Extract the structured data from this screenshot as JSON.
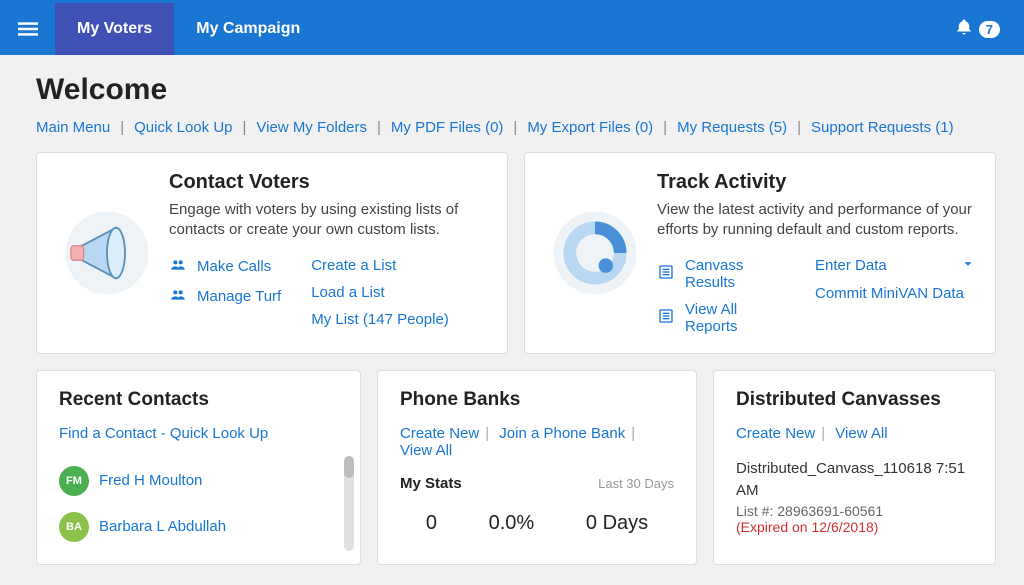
{
  "nav": {
    "items": [
      "My Voters",
      "My Campaign"
    ],
    "active_index": 0,
    "notification_count": "7"
  },
  "page": {
    "title": "Welcome"
  },
  "breadcrumb_links": [
    "Main Menu",
    "Quick Look Up",
    "View My Folders",
    "My PDF Files (0)",
    "My Export Files (0)",
    "My Requests (5)",
    "Support Requests (1)"
  ],
  "hero_cards": {
    "contact_voters": {
      "title": "Contact Voters",
      "subtitle": "Engage with voters by using existing lists of contacts or create your own custom lists.",
      "col1": [
        "Make Calls",
        "Manage Turf"
      ],
      "col2": [
        "Create a List",
        "Load a List",
        "My List (147 People)"
      ]
    },
    "track_activity": {
      "title": "Track Activity",
      "subtitle": "View the latest activity and performance of your efforts by running default and custom reports.",
      "col1": [
        "Canvass Results",
        "View All Reports"
      ],
      "col2": [
        "Enter Data",
        "Commit MiniVAN Data"
      ]
    }
  },
  "recent_contacts": {
    "title": "Recent Contacts",
    "find_link": "Find a Contact - Quick Look Up",
    "items": [
      {
        "initials": "FM",
        "name": "Fred H Moulton",
        "color": "green"
      },
      {
        "initials": "BA",
        "name": "Barbara L Abdullah",
        "color": "lime"
      }
    ]
  },
  "phone_banks": {
    "title": "Phone Banks",
    "links": [
      "Create New",
      "Join a Phone Bank",
      "View All"
    ],
    "stats_label": "My Stats",
    "period": "Last 30 Days",
    "stats": [
      "0",
      "0.0%",
      "0 Days"
    ]
  },
  "distributed": {
    "title": "Distributed Canvasses",
    "links": [
      "Create New",
      "View All"
    ],
    "item_name": "Distributed_Canvass_110618 7:51 AM",
    "list_line": "List #: 28963691-60561",
    "expired": "(Expired on 12/6/2018)"
  }
}
